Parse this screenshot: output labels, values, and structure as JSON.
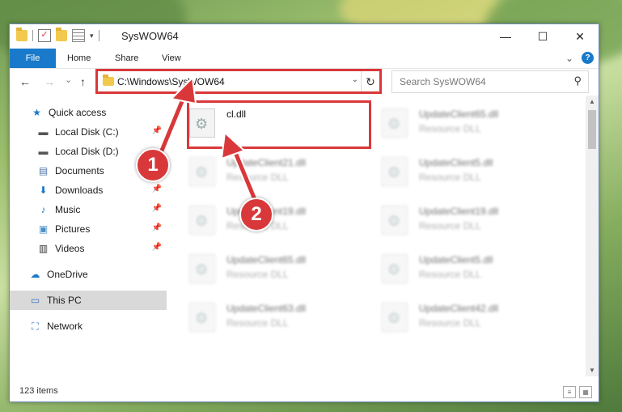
{
  "window": {
    "title": "SysWOW64",
    "minimize_glyph": "—",
    "maximize_glyph": "☐",
    "close_glyph": "✕"
  },
  "ribbon": {
    "tabs": [
      "File",
      "Home",
      "Share",
      "View"
    ],
    "expand_glyph": "⌄",
    "help_glyph": "?"
  },
  "nav": {
    "back_glyph": "←",
    "forward_glyph": "→",
    "recent_glyph": "⌄",
    "up_glyph": "↑",
    "address": "C:\\Windows\\SysWOW64",
    "address_dropdown_glyph": "⌄",
    "refresh_glyph": "↻",
    "search_placeholder": "Search SysWOW64",
    "search_glyph": "⚲"
  },
  "sidebar": {
    "items": [
      {
        "label": "Quick access",
        "icon": "star-icon",
        "glyph": "★",
        "color": "#1979ca"
      },
      {
        "label": "Local Disk (C:)",
        "icon": "disk-icon",
        "glyph": "▬",
        "color": "#555555",
        "pinned": true
      },
      {
        "label": "Local Disk (D:)",
        "icon": "disk-icon",
        "glyph": "▬",
        "color": "#555555"
      },
      {
        "label": "Documents",
        "icon": "document-icon",
        "glyph": "▤",
        "color": "#4a6fa5",
        "pinned": true
      },
      {
        "label": "Downloads",
        "icon": "download-icon",
        "glyph": "⬇",
        "color": "#1979ca",
        "pinned": true
      },
      {
        "label": "Music",
        "icon": "music-icon",
        "glyph": "♪",
        "color": "#1979ca",
        "pinned": true
      },
      {
        "label": "Pictures",
        "icon": "picture-icon",
        "glyph": "▣",
        "color": "#4a90c8",
        "pinned": true
      },
      {
        "label": "Videos",
        "icon": "video-icon",
        "glyph": "▥",
        "color": "#333333",
        "pinned": true
      },
      {
        "label": "OneDrive",
        "icon": "cloud-icon",
        "glyph": "☁",
        "color": "#1979ca"
      },
      {
        "label": "This PC",
        "icon": "computer-icon",
        "glyph": "▭",
        "color": "#3b7bbf"
      },
      {
        "label": "Network",
        "icon": "network-icon",
        "glyph": "⛶",
        "color": "#3b7bbf"
      }
    ],
    "pin_glyph": "📌"
  },
  "files": [
    {
      "name": "cl.dll",
      "type": ""
    },
    {
      "name": "UpdateClient65.dll",
      "type": "Resource DLL"
    },
    {
      "name": "UpdateClient21.dll",
      "type": "Resource DLL"
    },
    {
      "name": "UpdateClient5.dll",
      "type": "Resource DLL"
    },
    {
      "name": "UpdateClient19.dll",
      "type": "Resource DLL"
    },
    {
      "name": "UpdateClient19.dll",
      "type": "Resource DLL"
    },
    {
      "name": "UpdateClient65.dll",
      "type": "Resource DLL"
    },
    {
      "name": "UpdateClient5.dll",
      "type": "Resource DLL"
    },
    {
      "name": "UpdateClient63.dll",
      "type": "Resource DLL"
    },
    {
      "name": "UpdateClient42.dll",
      "type": "Resource DLL"
    }
  ],
  "status": {
    "item_count": "123 items"
  },
  "callouts": {
    "one": "1",
    "two": "2"
  },
  "colors": {
    "accent": "#1979ca",
    "highlight_red": "#d9383a"
  }
}
